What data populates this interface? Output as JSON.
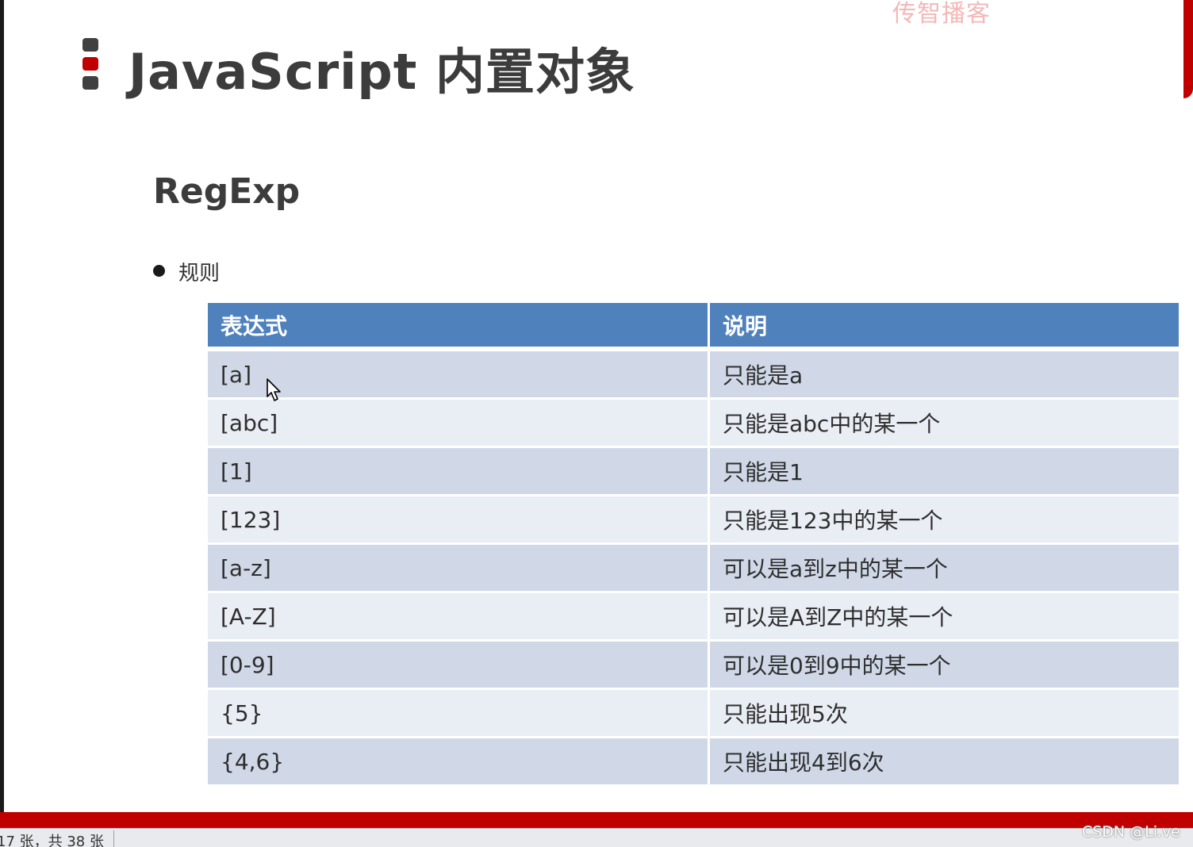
{
  "watermark": "传智播客",
  "slide": {
    "title": "JavaScript 内置对象",
    "section": "RegExp",
    "bullet": "规则"
  },
  "table": {
    "headers": [
      "表达式",
      "说明"
    ],
    "rows": [
      {
        "expr": "[a]",
        "desc": "只能是a"
      },
      {
        "expr": "[abc]",
        "desc": "只能是abc中的某一个"
      },
      {
        "expr": "[1]",
        "desc": "只能是1"
      },
      {
        "expr": "[123]",
        "desc": "只能是123中的某一个"
      },
      {
        "expr": "[a-z]",
        "desc": "可以是a到z中的某一个"
      },
      {
        "expr": "[A-Z]",
        "desc": "可以是A到Z中的某一个"
      },
      {
        "expr": "[0-9]",
        "desc": "可以是0到9中的某一个"
      },
      {
        "expr": "{5}",
        "desc": "只能出现5次"
      },
      {
        "expr": "{4,6}",
        "desc": "只能出现4到6次"
      }
    ]
  },
  "status_bar": {
    "slide_counter": "17 张，共 38 张"
  },
  "csdn_watermark": "CSDN @Li.ve",
  "colors": {
    "accent_red": "#c00000",
    "header_blue": "#4f81bd",
    "row_odd": "#d0d8e8",
    "row_even": "#e9edf4"
  },
  "icons": [
    "title-marker-icon",
    "bullet-icon",
    "mouse-cursor-icon"
  ]
}
